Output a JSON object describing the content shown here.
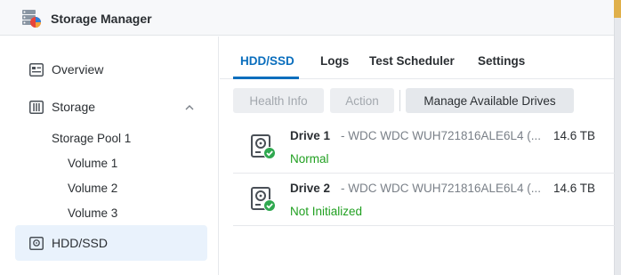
{
  "window": {
    "title": "Storage Manager",
    "app_icon": "storage-manager-icon"
  },
  "sidebar": {
    "items": [
      {
        "label": "Overview",
        "icon": "overview-icon"
      },
      {
        "label": "Storage",
        "icon": "storage-icon",
        "expanded": true
      },
      {
        "label": "HDD/SSD",
        "icon": "hdd-icon",
        "active": true
      }
    ],
    "storage_children": {
      "pool": "Storage Pool 1",
      "volumes": [
        "Volume 1",
        "Volume 2",
        "Volume 3"
      ]
    }
  },
  "tabs": [
    {
      "label": "HDD/SSD",
      "active": true
    },
    {
      "label": "Logs"
    },
    {
      "label": "Test Scheduler"
    },
    {
      "label": "Settings"
    }
  ],
  "toolbar": {
    "health_info": "Health Info",
    "action": "Action",
    "manage_drives": "Manage Available Drives"
  },
  "drives": [
    {
      "name": "Drive 1",
      "model": "- WDC WDC WUH721816ALE6L4 (...",
      "size": "14.6 TB",
      "status": "Normal"
    },
    {
      "name": "Drive 2",
      "model": "- WDC WDC WUH721816ALE6L4 (...",
      "size": "14.6 TB",
      "status": "Not Initialized"
    }
  ],
  "colors": {
    "accent": "#0a6ebd",
    "status_ok": "#21a021",
    "active_nav_bg": "#e9f2fc"
  }
}
